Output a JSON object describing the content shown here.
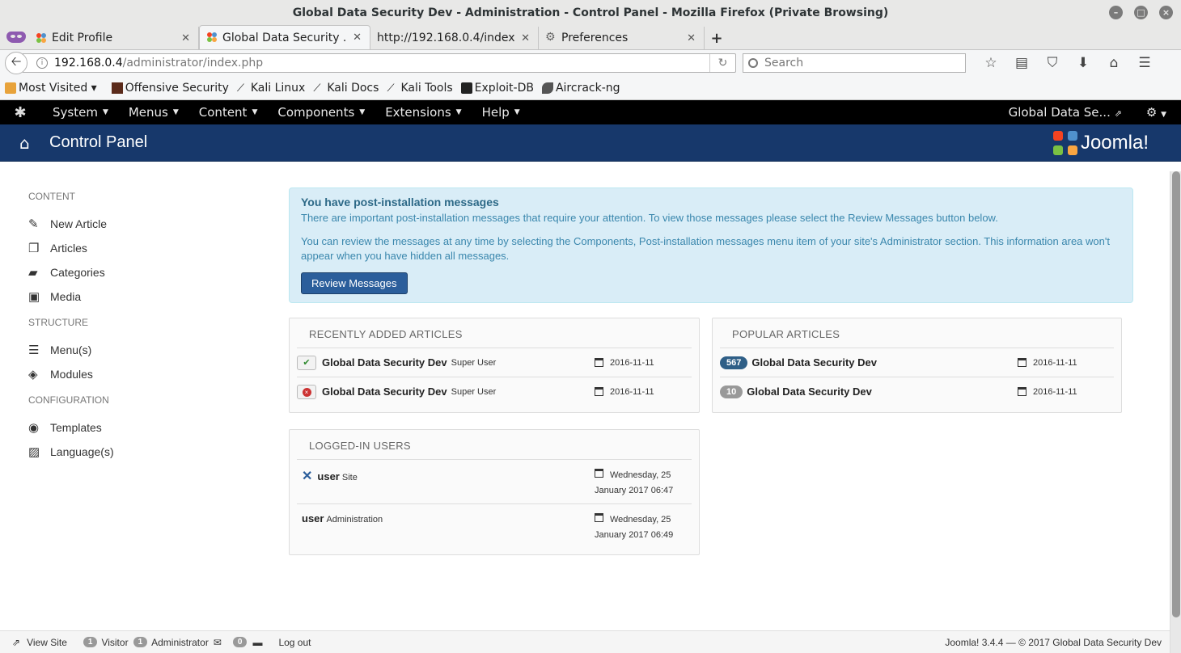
{
  "window": {
    "title": "Global Data Security Dev - Administration - Control Panel - Mozilla Firefox (Private Browsing)"
  },
  "tabs": [
    {
      "label": "Edit Profile",
      "favicon": "joomla-icon"
    },
    {
      "label": "Global Data Security ...",
      "favicon": "joomla-icon",
      "active": true
    },
    {
      "label": "http://192.168.0.4/index....",
      "favicon": "none"
    },
    {
      "label": "Preferences",
      "favicon": "gear-icon"
    }
  ],
  "url": {
    "host": "192.168.0.4",
    "path": "/administrator/index.php"
  },
  "search": {
    "placeholder": "Search"
  },
  "bookmarks": [
    "Most Visited ▾",
    "Offensive Security",
    "Kali Linux",
    "Kali Docs",
    "Kali Tools",
    "Exploit-DB",
    "Aircrack-ng"
  ],
  "topmenu": {
    "items": [
      "System",
      "Menus",
      "Content",
      "Components",
      "Extensions",
      "Help"
    ],
    "site_link": "Global Data Se..."
  },
  "header": {
    "title": "Control Panel",
    "brand": "Joomla!"
  },
  "sidebar": {
    "groups": [
      {
        "title": "CONTENT",
        "items": [
          "New Article",
          "Articles",
          "Categories",
          "Media"
        ]
      },
      {
        "title": "STRUCTURE",
        "items": [
          "Menu(s)",
          "Modules"
        ]
      },
      {
        "title": "CONFIGURATION",
        "items": [
          "Templates",
          "Language(s)"
        ]
      }
    ]
  },
  "alert": {
    "heading": "You have post-installation messages",
    "line1": "There are important post-installation messages that require your attention. To view those messages please select the Review Messages button below.",
    "line2": "You can review the messages at any time by selecting the Components, Post-installation messages menu item of your site's Administrator section. This information area won't appear when you have hidden all messages.",
    "button": "Review Messages"
  },
  "recent": {
    "title": "RECENTLY ADDED ARTICLES",
    "rows": [
      {
        "status": "✔",
        "title": "Global Data Security Dev",
        "author": "Super User",
        "date": "2016-11-11"
      },
      {
        "status": "×",
        "title": "Global Data Security Dev",
        "author": "Super User",
        "date": "2016-11-11"
      }
    ]
  },
  "popular": {
    "title": "POPULAR ARTICLES",
    "rows": [
      {
        "hits": "567",
        "title": "Global Data Security Dev",
        "date": "2016-11-11",
        "color": "#2f5f87"
      },
      {
        "hits": "10",
        "title": "Global Data Security Dev",
        "date": "2016-11-11",
        "color": "#999999"
      }
    ]
  },
  "logged": {
    "title": "LOGGED-IN USERS",
    "rows": [
      {
        "name": "user",
        "where": "Site",
        "date1": "Wednesday, 25",
        "date2": "January 2017 06:47"
      },
      {
        "name": "user",
        "where": "Administration",
        "date1": "Wednesday, 25",
        "date2": "January 2017 06:49"
      }
    ]
  },
  "footer": {
    "view_site": "View Site",
    "visitor_count": "1",
    "visitor_label": "Visitor",
    "admin_count": "1",
    "admin_label": "Administrator",
    "msg_count": "0",
    "logout": "Log out",
    "copyright": "Joomla! 3.4.4  — © 2017 Global Data Security Dev"
  }
}
